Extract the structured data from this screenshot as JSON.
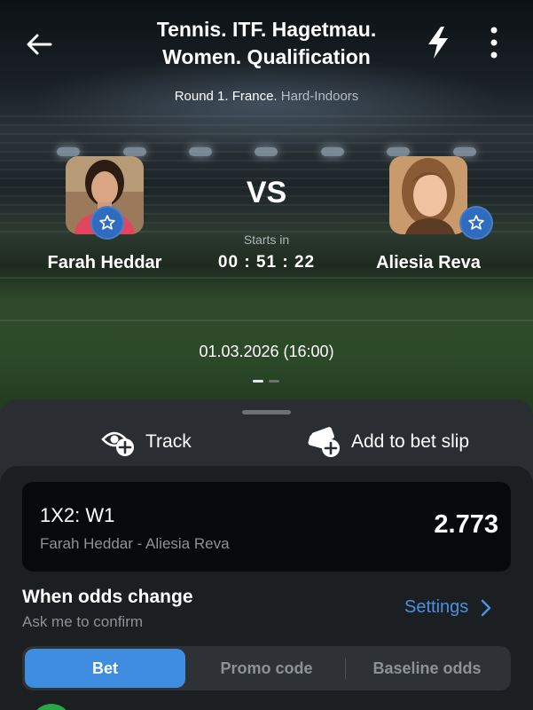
{
  "header": {
    "title_line1": "Tennis. ITF. Hagetmau.",
    "title_line2": "Women. Qualification",
    "round": "Round 1. France.",
    "surface": "Hard-Indoors"
  },
  "match": {
    "vs_label": "VS",
    "starts_in_label": "Starts in",
    "countdown": "00 : 51 : 22",
    "datetime": "01.03.2026 (16:00)",
    "player1": {
      "name": "Farah Heddar"
    },
    "player2": {
      "name": "Aliesia Reva"
    },
    "carousel_pages": 2,
    "carousel_active": 1
  },
  "actions": {
    "track_label": "Track",
    "bet_slip_label": "Add to bet slip"
  },
  "bet": {
    "market": "1X2: W1",
    "teams": "Farah Heddar - Aliesia Reva",
    "odds": "2.773"
  },
  "odds_change": {
    "label": "When odds change",
    "value": "Ask me to confirm",
    "settings_label": "Settings"
  },
  "tabs": [
    {
      "label": "Bet",
      "active": true
    },
    {
      "label": "Promo code",
      "active": false
    },
    {
      "label": "Baseline odds",
      "active": false
    }
  ],
  "colors": {
    "accent": "#3f8de0",
    "link": "#4a90e2",
    "favorite": "#2f6cc0"
  }
}
